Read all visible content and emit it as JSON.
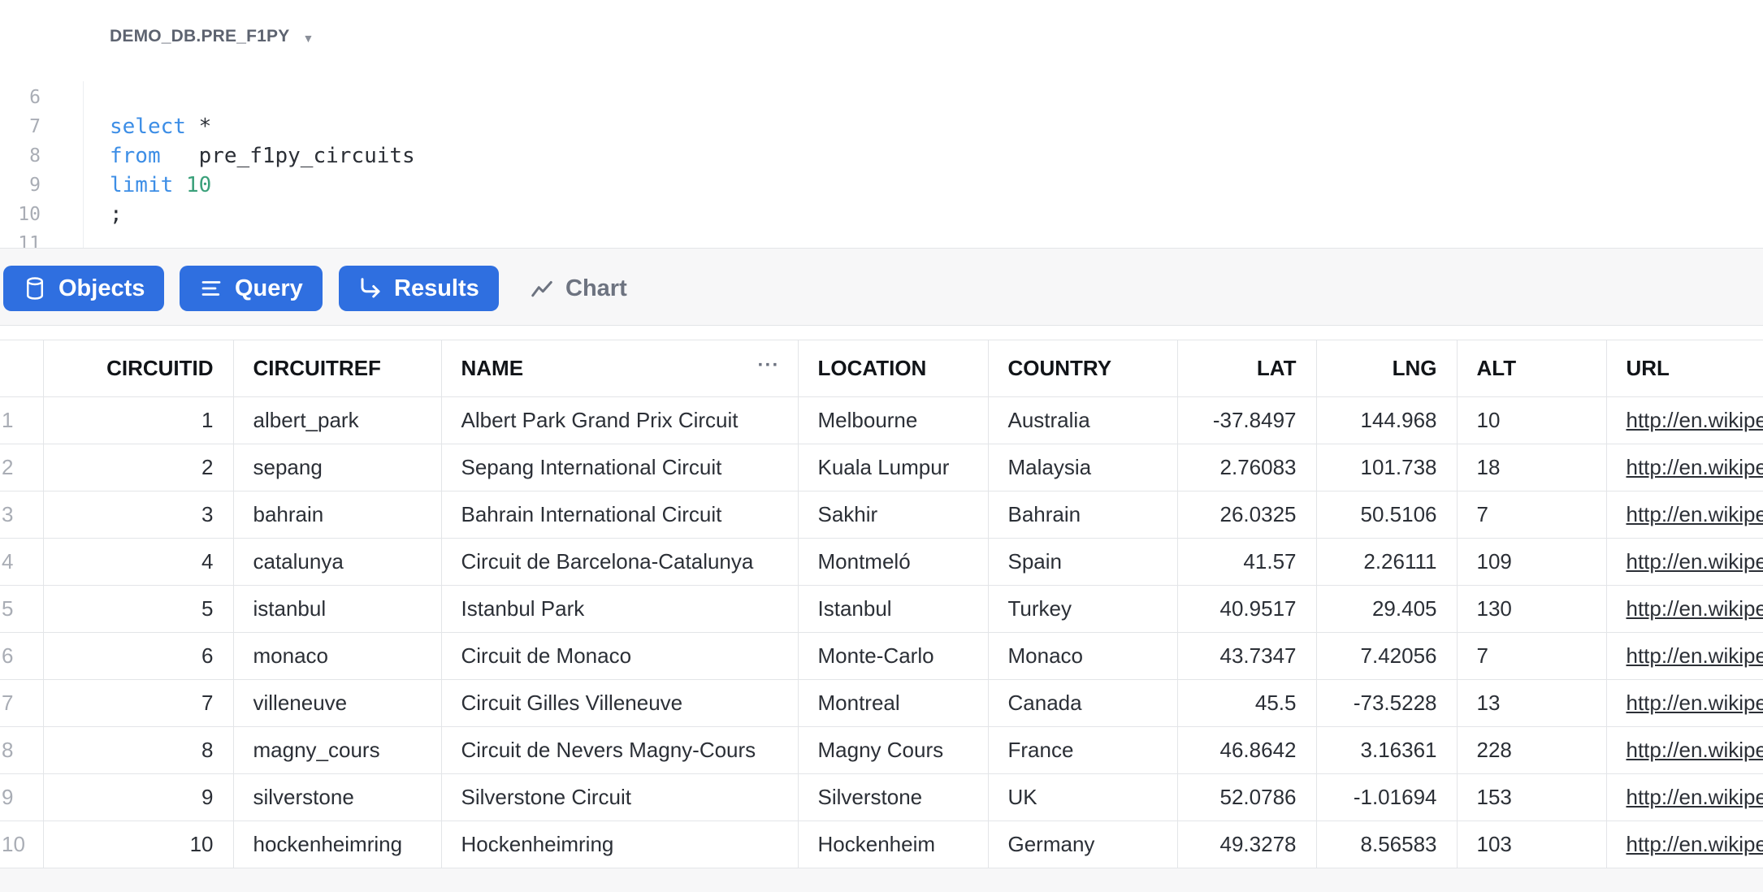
{
  "context": {
    "schema": "DEMO_DB.PRE_F1PY"
  },
  "editor": {
    "lines": [
      {
        "n": "6",
        "tokens": []
      },
      {
        "n": "7",
        "tokens": [
          {
            "t": "select",
            "c": "kw"
          },
          {
            "t": " *",
            "c": "plain"
          }
        ]
      },
      {
        "n": "8",
        "tokens": [
          {
            "t": "from",
            "c": "kw"
          },
          {
            "t": "   pre_f1py_circuits",
            "c": "plain"
          }
        ]
      },
      {
        "n": "9",
        "tokens": [
          {
            "t": "limit",
            "c": "kw"
          },
          {
            "t": " ",
            "c": "plain"
          },
          {
            "t": "10",
            "c": "num"
          }
        ]
      },
      {
        "n": "10",
        "tokens": [
          {
            "t": ";",
            "c": "plain"
          }
        ]
      },
      {
        "n": "11",
        "tokens": []
      }
    ]
  },
  "toolbar": {
    "objects_label": "Objects",
    "query_label": "Query",
    "results_label": "Results",
    "chart_label": "Chart"
  },
  "results": {
    "columns": [
      "CIRCUITID",
      "CIRCUITREF",
      "NAME",
      "LOCATION",
      "COUNTRY",
      "LAT",
      "LNG",
      "ALT",
      "URL"
    ],
    "rows": [
      [
        "1",
        "1",
        "albert_park",
        "Albert Park Grand Prix Circuit",
        "Melbourne",
        "Australia",
        "-37.8497",
        "144.968",
        "10",
        "http://en.wikipedia.org/wiki/Melbourne_Grand_Prix_Circuit"
      ],
      [
        "2",
        "2",
        "sepang",
        "Sepang International Circuit",
        "Kuala Lumpur",
        "Malaysia",
        "2.76083",
        "101.738",
        "18",
        "http://en.wikipedia.org/wiki/Sepang_International_Circuit"
      ],
      [
        "3",
        "3",
        "bahrain",
        "Bahrain International Circuit",
        "Sakhir",
        "Bahrain",
        "26.0325",
        "50.5106",
        "7",
        "http://en.wikipedia.org/wiki/Bahrain_International_Circuit"
      ],
      [
        "4",
        "4",
        "catalunya",
        "Circuit de Barcelona-Catalunya",
        "Montmeló",
        "Spain",
        "41.57",
        "2.26111",
        "109",
        "http://en.wikipedia.org/wiki/Circuit_de_Barcelona-Catalunya"
      ],
      [
        "5",
        "5",
        "istanbul",
        "Istanbul Park",
        "Istanbul",
        "Turkey",
        "40.9517",
        "29.405",
        "130",
        "http://en.wikipedia.org/wiki/Istanbul_Park"
      ],
      [
        "6",
        "6",
        "monaco",
        "Circuit de Monaco",
        "Monte-Carlo",
        "Monaco",
        "43.7347",
        "7.42056",
        "7",
        "http://en.wikipedia.org/wiki/Circuit_de_Monaco"
      ],
      [
        "7",
        "7",
        "villeneuve",
        "Circuit Gilles Villeneuve",
        "Montreal",
        "Canada",
        "45.5",
        "-73.5228",
        "13",
        "http://en.wikipedia.org/wiki/Circuit_Gilles_Villeneuve"
      ],
      [
        "8",
        "8",
        "magny_cours",
        "Circuit de Nevers Magny-Cours",
        "Magny Cours",
        "France",
        "46.8642",
        "3.16361",
        "228",
        "http://en.wikipedia.org/wiki/Circuit_de_Nevers_Magny-Cours"
      ],
      [
        "9",
        "9",
        "silverstone",
        "Silverstone Circuit",
        "Silverstone",
        "UK",
        "52.0786",
        "-1.01694",
        "153",
        "http://en.wikipedia.org/wiki/Silverstone_Circuit"
      ],
      [
        "10",
        "10",
        "hockenheimring",
        "Hockenheimring",
        "Hockenheim",
        "Germany",
        "49.3278",
        "8.56583",
        "103",
        "http://en.wikipedia.org/wiki/Hockenheimring"
      ]
    ]
  },
  "colors": {
    "accent": "#2f6fe0",
    "keyword": "#3d8ee6",
    "number": "#3aa07a"
  }
}
